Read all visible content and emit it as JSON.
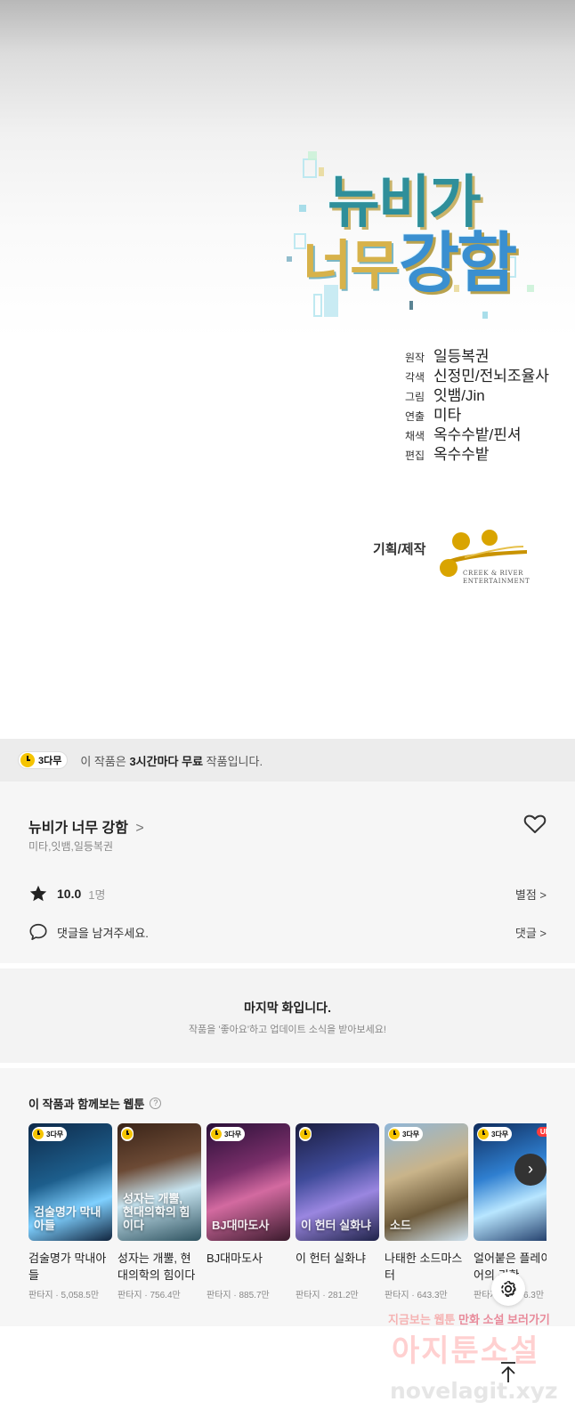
{
  "comic": {
    "logo_line1": "뉴비가",
    "logo_line2a": "너무",
    "logo_line2b": "강함",
    "credits": [
      {
        "role": "원작",
        "name": "일등복권"
      },
      {
        "role": "각색",
        "name": "신정민/전뇌조율사"
      },
      {
        "role": "그림",
        "name": "잇뱀/Jin"
      },
      {
        "role": "연출",
        "name": "미타"
      },
      {
        "role": "채색",
        "name": "옥수수밭/핀셔"
      },
      {
        "role": "편집",
        "name": "옥수수밭"
      }
    ],
    "production_label": "기획/제작",
    "studio_line1": "CREEK & RIVER",
    "studio_line2": "ENTERTAINMENT"
  },
  "notice": {
    "badge": "3다무",
    "prefix": "이 작품은 ",
    "bold": "3시간마다 무료",
    "suffix": " 작품입니다."
  },
  "work": {
    "title": "뉴비가 너무 강함",
    "title_chevron": ">",
    "authors": "미타,잇뱀,일등복권",
    "rating": "10.0",
    "rating_count": "1명",
    "rating_link": "별점 >",
    "comment_prompt": "댓글을 남겨주세요.",
    "comment_link": "댓글 >"
  },
  "last_episode": {
    "title": "마지막 화입니다.",
    "subtitle": "작품을 '좋아요'하고 업데이트 소식을 받아보세요!"
  },
  "recommendations": {
    "title": "이 작품과 함께보는 웹툰",
    "help": "?",
    "next": "›",
    "items": [
      {
        "name": "검술명가 막내아들",
        "meta": "판타지 · 5,058.5만",
        "badge": "3다무",
        "up": "",
        "thumb_title": "검술명가 막내아들",
        "bg": "linear-gradient(160deg,#0e2a4a 0%,#1d5e8c 45%,#7fd0ff 70%,#10243d 100%)"
      },
      {
        "name": "성자는 개뿔, 현대의학의 힘이다",
        "meta": "판타지 · 756.4만",
        "badge": "",
        "up": "",
        "thumb_title": "성자는 개뿔, 현대의학의 힘이다",
        "bg": "linear-gradient(165deg,#3a2418 0%,#6c4a35 35%,#c7e4f0 60%,#2f5360 100%)"
      },
      {
        "name": "BJ대마도사",
        "meta": "판타지 · 885.7만",
        "badge": "3다무",
        "up": "",
        "thumb_title": "BJ대마도사",
        "bg": "linear-gradient(160deg,#2a1038 0%,#7a2f6a 40%,#d36aa0 60%,#3a1a2c 100%)"
      },
      {
        "name": "이 헌터 실화냐",
        "meta": "판타지 · 281.2만",
        "badge": "",
        "up": "",
        "thumb_title": "이 헌터 실화냐",
        "bg": "linear-gradient(160deg,#1b1d3f 0%,#3f4b9a 40%,#9a86e0 65%,#1e2248 100%)"
      },
      {
        "name": "나태한 소드마스터",
        "meta": "판타지 · 643.3만",
        "badge": "3다무",
        "up": "",
        "thumb_title": "소드",
        "bg": "linear-gradient(160deg,#8fb6d8 0%,#c9b48a 40%,#6d5a3a 70%,#cfe2ef 100%)"
      },
      {
        "name": "얼어붙은 플레이어의 귀환",
        "meta": "판타지 · 3,506.3만",
        "badge": "3다무",
        "up": "UP",
        "thumb_title": "",
        "bg": "linear-gradient(160deg,#0f2c5c 0%,#2f7fd0 40%,#b8e6ff 65%,#1a3563 100%)"
      }
    ]
  },
  "watermark": {
    "line1a": "지금보는 웹툰 ",
    "line1b": "만화 소설 보러가기",
    "line2": "아지툰소설",
    "line3": "novelagit.xyz"
  },
  "colors": {
    "accent_yellow": "#f5c400",
    "up_red": "#ff3b3b"
  },
  "icons": {
    "heart": "heart-icon",
    "star": "star-icon",
    "comment": "comment-icon",
    "settings": "gear-icon",
    "scroll_top": "arrow-up-icon"
  }
}
